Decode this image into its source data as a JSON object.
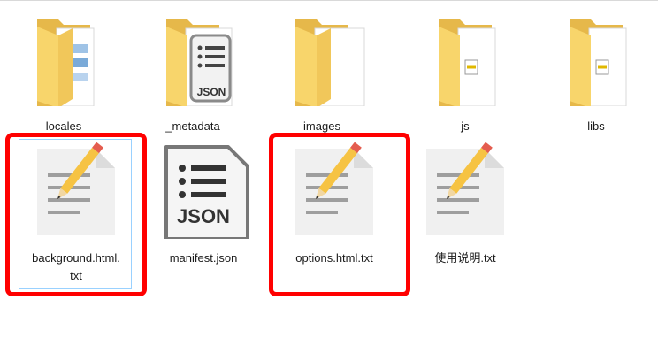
{
  "folders": [
    {
      "name": "locales",
      "icon": "folder-icon"
    },
    {
      "name": "_metadata",
      "icon": "folder-icon"
    },
    {
      "name": "images",
      "icon": "folder-icon"
    },
    {
      "name": "js",
      "icon": "folder-icon"
    },
    {
      "name": "libs",
      "icon": "folder-icon"
    }
  ],
  "files": [
    {
      "name": "background.html.txt",
      "line1": "background.html.",
      "line2": "txt",
      "icon": "text-file-icon",
      "highlighted": true
    },
    {
      "name": "manifest.json",
      "line1": "manifest.json",
      "icon": "json-file-icon",
      "highlighted": false
    },
    {
      "name": "options.html.txt",
      "line1": "options.html.txt",
      "icon": "text-file-icon",
      "highlighted": true
    },
    {
      "name": "使用说明.txt",
      "line1": "使用说明.txt",
      "icon": "text-file-icon",
      "highlighted": false
    }
  ],
  "overlay_text": {
    "json_badge": "JSON"
  },
  "colors": {
    "highlight": "#ff0000",
    "selection": "#99d1ff",
    "folder": "#f8d56b"
  }
}
